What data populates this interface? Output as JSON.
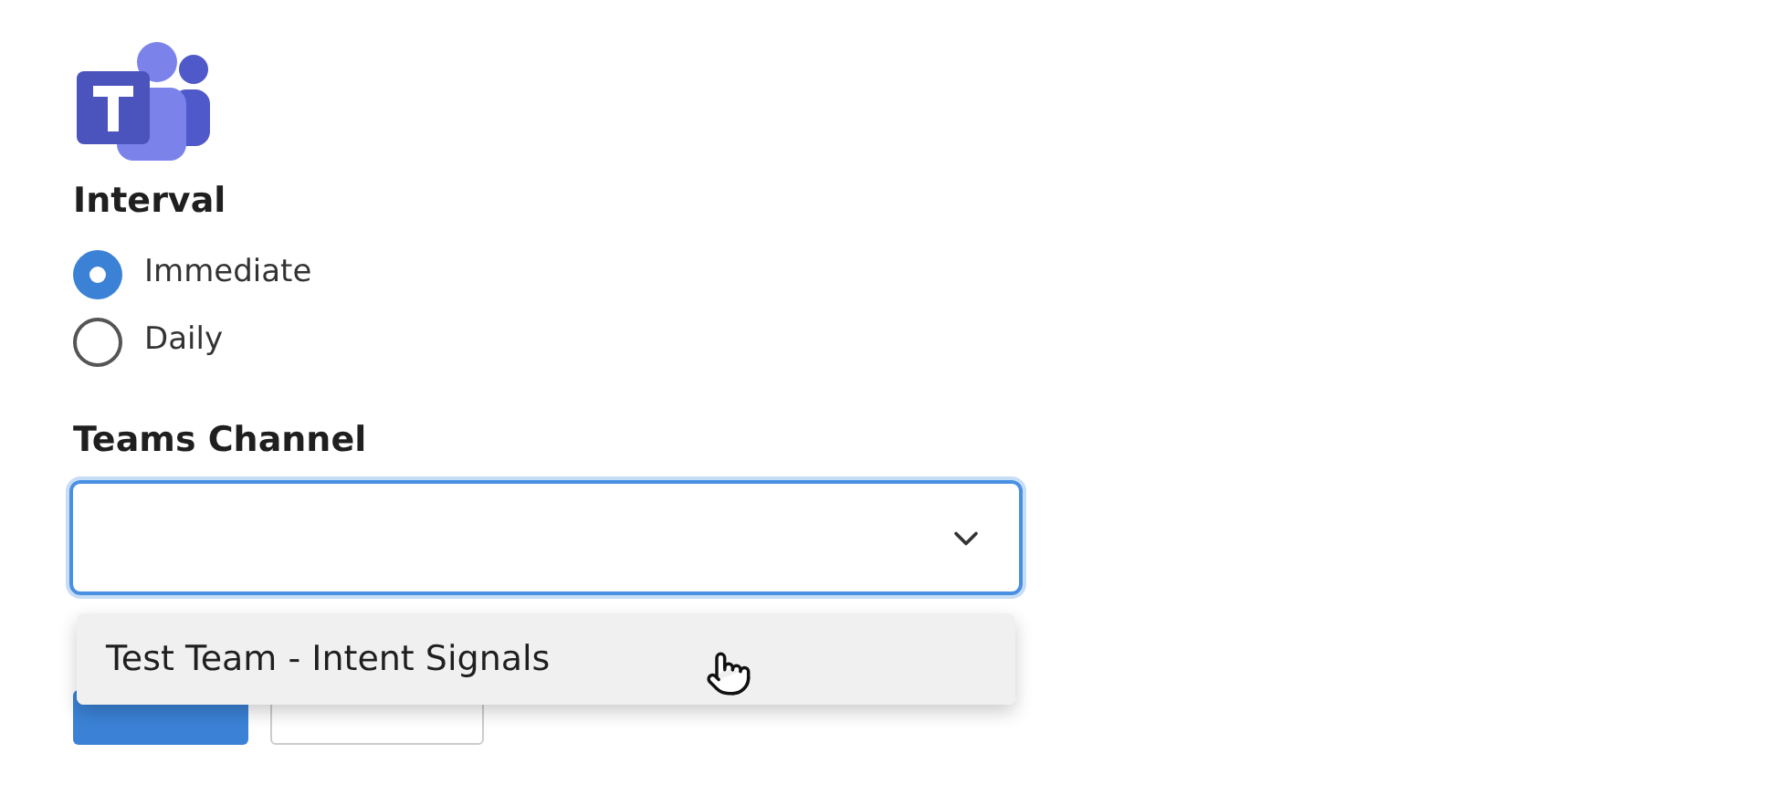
{
  "interval": {
    "label": "Interval",
    "options": [
      {
        "label": "Immediate",
        "selected": true
      },
      {
        "label": "Daily",
        "selected": false
      }
    ]
  },
  "teams_channel": {
    "label": "Teams Channel",
    "expanded": true,
    "options": [
      {
        "label": "Test Team - Intent Signals",
        "highlighted": true
      }
    ]
  }
}
